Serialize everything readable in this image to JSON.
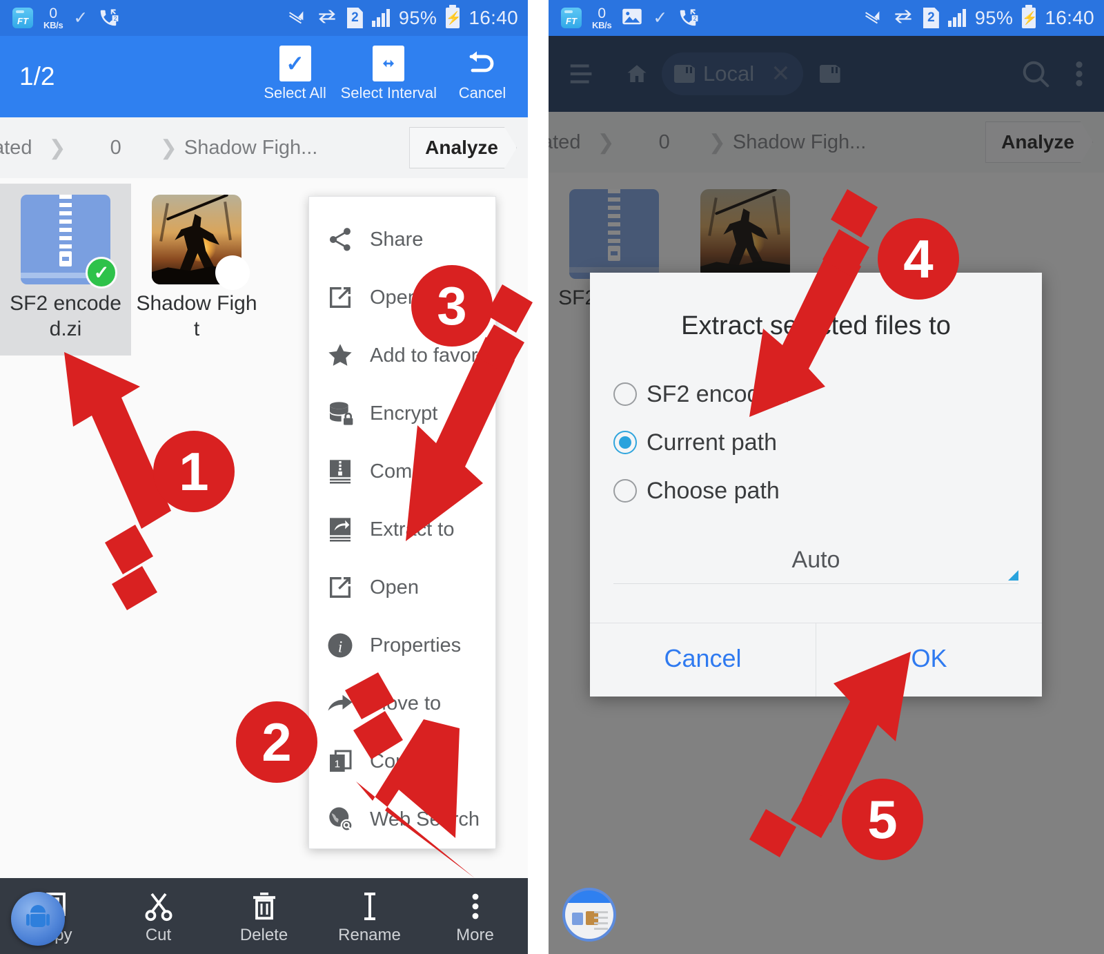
{
  "status_bar": {
    "app_icon": "es-file-explorer-icon",
    "net_speed_value": "0",
    "net_speed_unit": "KB/s",
    "check_icon": "check-icon",
    "missed_call_icon": "call-forward-icon",
    "mute_icon": "mute-icon",
    "data_sync_icon": "data-transfer-icon",
    "sim_label": "2",
    "signal_icon": "signal-bars-icon",
    "battery_percent": "95%",
    "battery_icon": "battery-charging-icon",
    "clock": "16:40"
  },
  "left_panel": {
    "selection_bar": {
      "count": "1/2",
      "actions": [
        {
          "label": "Select All",
          "icon": "check-box-icon"
        },
        {
          "label": "Select Interval",
          "icon": "arrows-horizontal-icon"
        },
        {
          "label": "Cancel",
          "icon": "undo-arrow-icon"
        }
      ]
    },
    "breadcrumb": {
      "items": [
        "ated",
        "0",
        "Shadow Figh..."
      ],
      "analyze_label": "Analyze"
    },
    "files": [
      {
        "name": "SF2 encoded.zi",
        "thumb": "zip-archive-icon",
        "selected": true,
        "badge": "check"
      },
      {
        "name": "Shadow Fight",
        "thumb": "shadow-fight-app-icon",
        "selected": false,
        "badge": "empty"
      }
    ],
    "context_menu": [
      {
        "label": "Share",
        "icon": "share-icon"
      },
      {
        "label": "Open As",
        "icon": "open-external-icon"
      },
      {
        "label": "Add to favor..",
        "icon": "star-icon"
      },
      {
        "label": "Encrypt",
        "icon": "database-lock-icon"
      },
      {
        "label": "Compress",
        "icon": "compress-icon"
      },
      {
        "label": "Extract to",
        "icon": "extract-icon"
      },
      {
        "label": "Open",
        "icon": "open-external-icon"
      },
      {
        "label": "Properties",
        "icon": "info-icon"
      },
      {
        "label": "Move to",
        "icon": "move-arrow-icon"
      },
      {
        "label": "Copy to",
        "icon": "copy-icon"
      },
      {
        "label": "Web Search",
        "icon": "web-search-icon"
      }
    ],
    "bottom_bar": [
      {
        "label": "Copy",
        "icon": "copy-icon"
      },
      {
        "label": "Cut",
        "icon": "scissors-icon"
      },
      {
        "label": "Delete",
        "icon": "trash-icon"
      },
      {
        "label": "Rename",
        "icon": "text-cursor-icon"
      },
      {
        "label": "More",
        "icon": "overflow-dots-icon"
      }
    ],
    "floating_bubble_icon": "android-robot-icon"
  },
  "right_panel": {
    "toolbar": {
      "menu_icon": "hamburger-menu-icon",
      "home_icon": "home-icon",
      "tab_label": "Local",
      "tab_close_icon": "close-icon",
      "tab_add_icon": "sd-card-icon",
      "search_icon": "search-icon",
      "overflow_icon": "overflow-dots-icon"
    },
    "breadcrumb": {
      "items": [
        "ated",
        "0",
        "Shadow Figh..."
      ],
      "analyze_label": "Analyze"
    },
    "files": [
      {
        "name": "SF2 encoded.zi",
        "thumb": "zip-archive-icon"
      },
      {
        "name": "Shadow Fight",
        "thumb": "shadow-fight-app-icon"
      }
    ],
    "dialog": {
      "title": "Extract selected files to",
      "options": [
        {
          "label": "SF2 encoded/",
          "selected": false
        },
        {
          "label": "Current path",
          "selected": true
        },
        {
          "label": "Choose path",
          "selected": false
        }
      ],
      "spinner_value": "Auto",
      "cancel_label": "Cancel",
      "ok_label": "OK"
    },
    "floating_screenshot_icon": "screenshot-preview-bubble"
  },
  "annotations": {
    "accent_color": "#d92121",
    "steps": [
      {
        "number": "1",
        "target": "SF2 encoded.zi file tile"
      },
      {
        "number": "2",
        "target": "More button"
      },
      {
        "number": "3",
        "target": "Extract to menu item"
      },
      {
        "number": "4",
        "target": "Extract selected files to dialog"
      },
      {
        "number": "5",
        "target": "OK button"
      }
    ]
  },
  "colors": {
    "status_bar": "#2a74e0",
    "selection_bar": "#2f80f0",
    "right_toolbar": "#1f3a63",
    "bottom_bar": "#343a43",
    "selected_check": "#2ec24a",
    "dialog_accent": "#2f7af0",
    "radio_selected": "#2aa3dd"
  }
}
